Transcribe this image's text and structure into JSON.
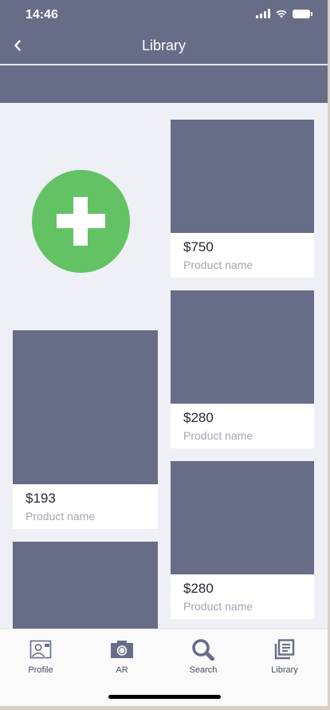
{
  "status_bar": {
    "time": "14:46"
  },
  "header": {
    "title": "Library",
    "back_icon": "chevron-left-icon"
  },
  "add_button": {
    "icon": "plus-icon",
    "color": "#62c264"
  },
  "products": [
    {
      "price": "$750",
      "name": "Product name"
    },
    {
      "price": "$280",
      "name": "Product name"
    },
    {
      "price": "$193",
      "name": "Product name"
    },
    {
      "price": "$280",
      "name": "Product name"
    }
  ],
  "tabs": [
    {
      "label": "Profile",
      "icon": "profile-card-icon"
    },
    {
      "label": "AR",
      "icon": "camera-icon"
    },
    {
      "label": "Search",
      "icon": "search-icon"
    },
    {
      "label": "Library",
      "icon": "library-icon"
    }
  ],
  "colors": {
    "primary": "#676d87",
    "background": "#eef0f6",
    "accent": "#62c264"
  }
}
